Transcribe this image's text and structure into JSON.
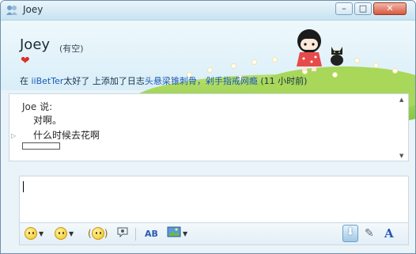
{
  "window": {
    "title": "Joey",
    "buttons": {
      "minimize": "–",
      "maximize": "□",
      "close": "✕"
    }
  },
  "header": {
    "contact_name": "Joey",
    "status": "(有空)",
    "status_icon": "heart-icon",
    "activity": {
      "prefix": "在 ",
      "link1": "iiBetTer",
      "middle1": "太好了 上添加了日志",
      "link2": "头悬梁锥刺骨，剁手指戒网瘾",
      "time": "  (11 小时前)"
    }
  },
  "chat": {
    "sender": "Joe 说:",
    "messages": [
      "对啊。",
      "什么时候去花啊"
    ]
  },
  "input": {
    "value": ""
  },
  "toolbar": {
    "items": [
      "emoticon-icon",
      "wink-icon",
      "nudge-icon",
      "voice-clip-icon",
      "font-change-icon",
      "background-icon",
      "send-down-icon",
      "handwriting-icon",
      "font-icon"
    ],
    "font_label": "A"
  },
  "colors": {
    "accent": "#1a5bb8",
    "title_bg": "#c7e3f1",
    "hill": "#7fc33b",
    "heart": "#d8322c"
  }
}
